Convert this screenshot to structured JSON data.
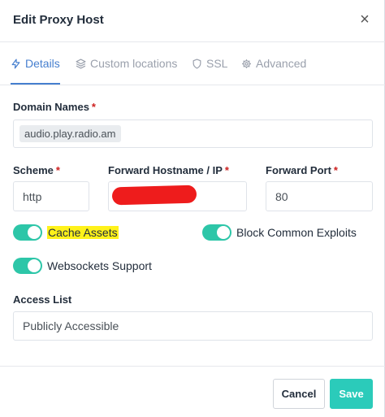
{
  "modal": {
    "title": "Edit Proxy Host",
    "close_glyph": "×"
  },
  "tabs": [
    {
      "label": "Details",
      "icon": "bolt-icon",
      "active": true
    },
    {
      "label": "Custom locations",
      "icon": "layers-icon",
      "active": false
    },
    {
      "label": "SSL",
      "icon": "shield-icon",
      "active": false
    },
    {
      "label": "Advanced",
      "icon": "gear-icon",
      "active": false
    }
  ],
  "form": {
    "domain_names": {
      "label": "Domain Names",
      "required_mark": "*",
      "values": [
        "audio.play.radio.am"
      ]
    },
    "scheme": {
      "label": "Scheme",
      "required_mark": "*",
      "value": "http"
    },
    "forward_hostname": {
      "label": "Forward Hostname / IP",
      "required_mark": "*",
      "value": ""
    },
    "forward_port": {
      "label": "Forward Port",
      "required_mark": "*",
      "value": "80"
    },
    "toggles": {
      "cache_assets": {
        "label": "Cache Assets",
        "enabled": true
      },
      "block_exploits": {
        "label": "Block Common Exploits",
        "enabled": true
      },
      "websockets": {
        "label": "Websockets Support",
        "enabled": true
      }
    },
    "access_list": {
      "label": "Access List",
      "value": "Publicly Accessible"
    }
  },
  "footer": {
    "cancel_label": "Cancel",
    "save_label": "Save"
  },
  "colors": {
    "accent": "#467fcf",
    "toggle_on": "#2dc6a8",
    "save_button": "#2bcbba",
    "required": "#cd201f",
    "redaction": "#ee1c1c",
    "highlight": "#fff21a"
  }
}
